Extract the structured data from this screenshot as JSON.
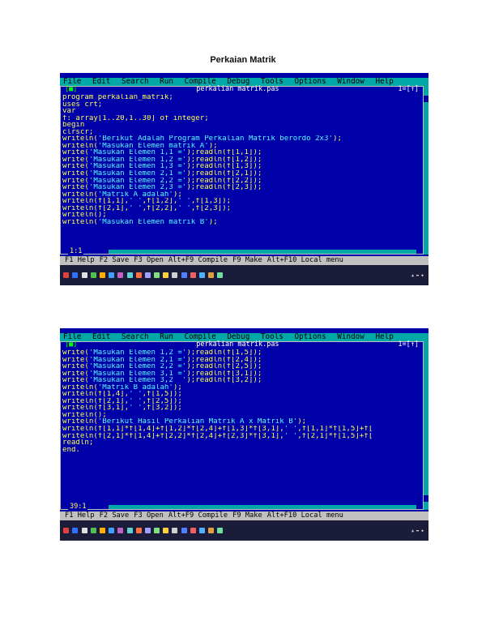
{
  "page": {
    "title": "Perkaian Matrik"
  },
  "screens": [
    {
      "menu": [
        "File",
        "Edit",
        "Search",
        "Run",
        "Compile",
        "Debug",
        "Tools",
        "Options",
        "Window",
        "Help"
      ],
      "window": {
        "close": "[■]",
        "filename": "perkalian matrik.pas",
        "number": "1=[↑]"
      },
      "position": "1:1",
      "status": [
        "F1 Help",
        "F2 Save",
        "F3 Open",
        "Alt+F9 Compile",
        "F9 Make",
        "Alt+F10 Local menu"
      ],
      "code": [
        "program perkalian_matrik;",
        "uses crt;",
        "var",
        "f: array[1..20,1..30] of integer;",
        "begin",
        "clrscr;",
        "writeln('Berikut Adalah Program Perkalian Matrik berordo 2x3');",
        "writeln('Masukan Elemen matrik A');",
        "write('Masukan Elemen 1,1 =');readln(f[1,1]);",
        "write('Masukan Elemen 1,2 =');readln(f[1,2]);",
        "write('Masukan Elemen 1,3 =');readln(f[1,3]);",
        "write('Masukan Elemen 2,1 =');readln(f[2,1]);",
        "write('Masukan Elemen 2,2 =');readln(f[2,2]);",
        "write('Masukan Elemen 2,3 =');readln(f[2,3]);",
        "writeln('Matrik A adalah');",
        "writeln(f[1,1],' ',f[1,2],' ',f[1,3]);",
        "writeln(f[2,1],' ',f[2,2],' ',f[2,3]);",
        "writeln();",
        "writeln('Masukan Elemen matrik B');"
      ]
    },
    {
      "menu": [
        "File",
        "Edit",
        "Search",
        "Run",
        "Compile",
        "Debug",
        "Tools",
        "Options",
        "Window",
        "Help"
      ],
      "window": {
        "close": "[■]",
        "filename": "perkalian matrik.pas",
        "number": "1=[↑]"
      },
      "position": "39:1",
      "status": [
        "F1 Help",
        "F2 Save",
        "F3 Open",
        "Alt+F9 Compile",
        "F9 Make",
        "Alt+F10 Local menu"
      ],
      "code": [
        "write('Masukan Elemen 1,2 =');readln(f[1,5]);",
        "write('Masukan Elemen 2,1 =');readln(f[2,4]);",
        "write('Masukan Elemen 2,2 =');readln(f[2,5]);",
        "write('Masukan Elemen 3,1 =');readln(f[3,1]);",
        "write('Masukan Elemen 3,2  ');readln(f[3,2]);",
        "writeln('Matrik B adalah');",
        "writeln(f[1,4],' ',f[1,5]);",
        "writeln(f[2,1],' ',f[2,5]);",
        "writeln(f[3,1],' ',f[3,2]);",
        "writeln();",
        "writeln('Berikut Hasil Perkalian Matrik A x Matrik B');",
        "writeln(f[1,1]*f[1,4]+f[1,2]*f[2,4]+f[1,3]*f[3,1],' ',f[1,1]*f[1,5]+f[",
        "writeln(f[2,1]*f[1,4]+f[2,2]*f[2,4]+f[2,3]*f[3,1],' ',f[2,1]*f[1,5]+f[",
        "readln;",
        "end."
      ]
    }
  ],
  "colors": {
    "editor_bg": "#0000a8",
    "menu_bg": "#00a8a8",
    "status_bg": "#c0c0c0",
    "string_literal": "#55ffff",
    "keyword": "#ffff55"
  }
}
